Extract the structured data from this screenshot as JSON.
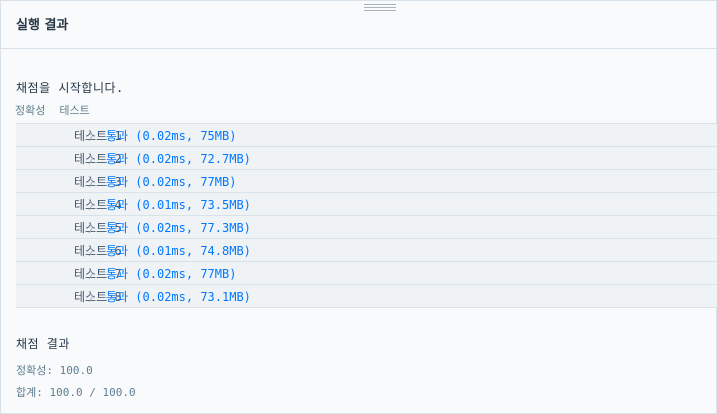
{
  "header": {
    "title": "실행 결과"
  },
  "console": {
    "start_message": "채점을 시작합니다.",
    "section_labels": [
      "정확성",
      "테스트"
    ],
    "tests": [
      {
        "name": "테스트 1",
        "arrow": "〉",
        "result": "통과 (0.02ms, 75MB)"
      },
      {
        "name": "테스트 2",
        "arrow": "〉",
        "result": "통과 (0.02ms, 72.7MB)"
      },
      {
        "name": "테스트 3",
        "arrow": "〉",
        "result": "통과 (0.02ms, 77MB)"
      },
      {
        "name": "테스트 4",
        "arrow": "〉",
        "result": "통과 (0.01ms, 73.5MB)"
      },
      {
        "name": "테스트 5",
        "arrow": "〉",
        "result": "통과 (0.02ms, 77.3MB)"
      },
      {
        "name": "테스트 6",
        "arrow": "〉",
        "result": "통과 (0.01ms, 74.8MB)"
      },
      {
        "name": "테스트 7",
        "arrow": "〉",
        "result": "통과 (0.02ms, 77MB)"
      },
      {
        "name": "테스트 8",
        "arrow": "〉",
        "result": "통과 (0.02ms, 73.1MB)"
      }
    ]
  },
  "summary": {
    "title": "채점 결과",
    "accuracy": "정확성: 100.0",
    "total": "합계: 100.0 / 100.0"
  },
  "colors": {
    "pass": "#0078ff",
    "text": "#263747",
    "muted": "#5f7f90",
    "border": "#d7e2eb"
  }
}
